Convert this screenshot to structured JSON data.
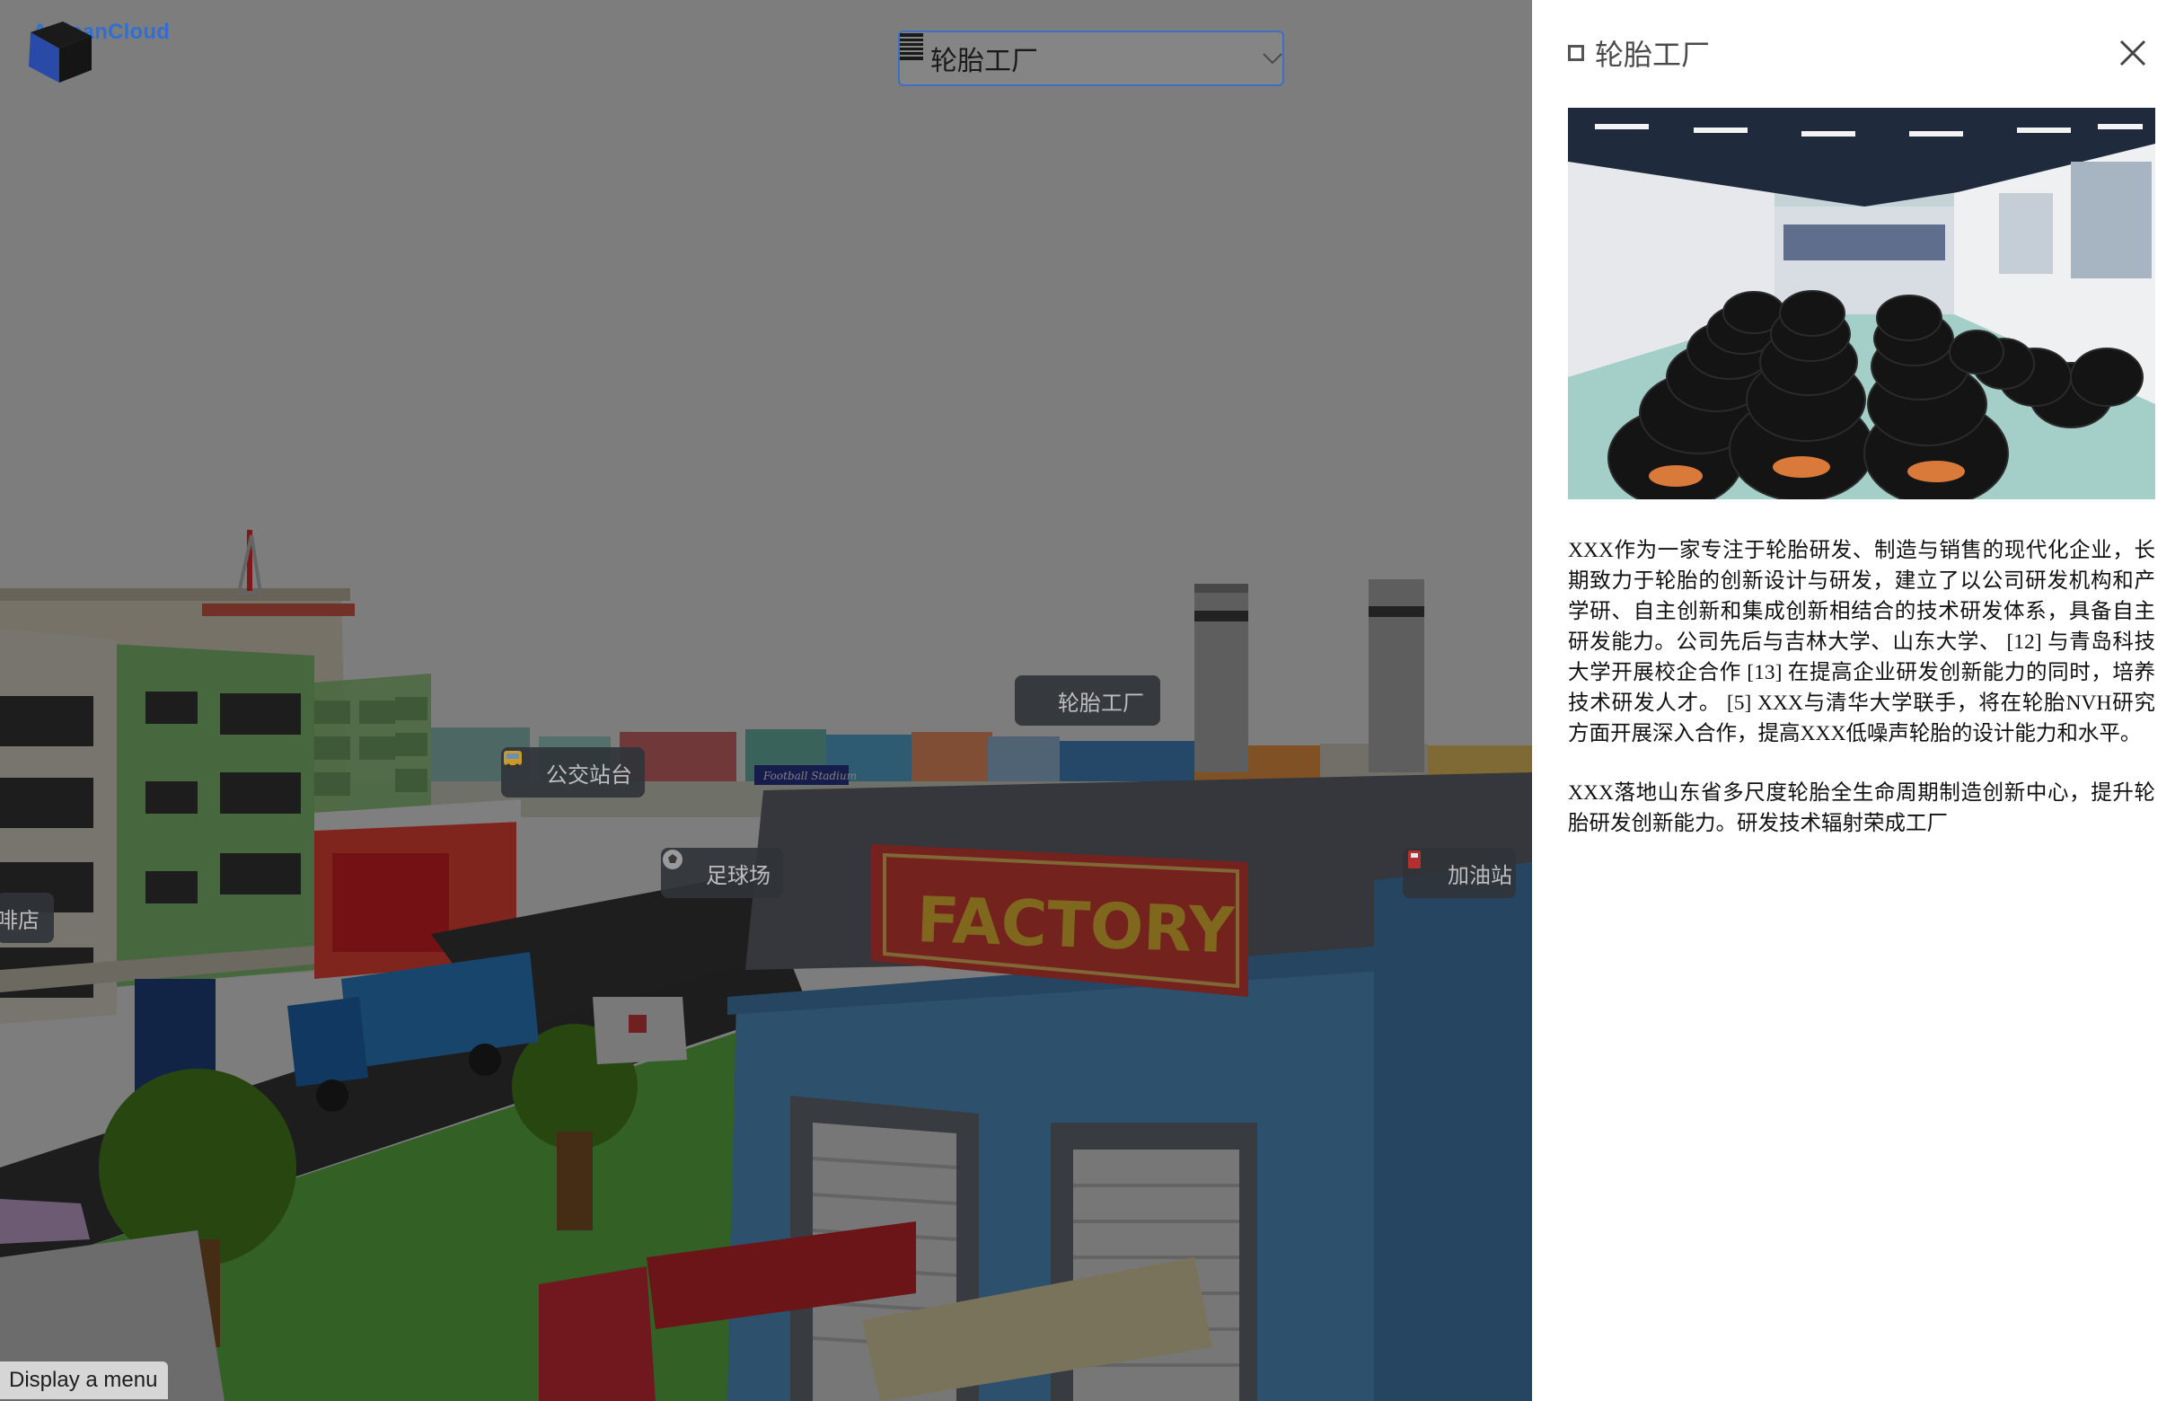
{
  "app": {
    "logo_text": "ArtisanCloud"
  },
  "location_select": {
    "selected": "轮胎工厂"
  },
  "scene": {
    "labels": {
      "bus_stop": "公交站台",
      "football": "足球场",
      "gas_station": "加油站",
      "tire_factory": "轮胎工厂",
      "cafe_partial": "啡店"
    },
    "signs": {
      "factory": "FACTORY",
      "stadium": "Football Stadium"
    }
  },
  "menu_button": {
    "label": "Display a menu"
  },
  "detail_panel": {
    "title": "轮胎工厂",
    "paragraphs": [
      "XXX作为一家专注于轮胎研发、制造与销售的现代化企业，长期致力于轮胎的创新设计与研发，建立了以公司研发机构和产学研、自主创新和集成创新相结合的技术研发体系，具备自主研发能力。公司先后与吉林大学、山东大学、 [12] 与青岛科技大学开展校企合作 [13] 在提高企业研发创新能力的同时，培养技术研发人才。 [5] XXX与清华大学联手，将在轮胎NVH研究方面开展深入合作，提高XXX低噪声轮胎的设计能力和水平。",
      "XXX落地山东省多尺度轮胎全生命周期制造创新中心，提升轮胎研发创新能力。研发技术辐射荣成工厂"
    ]
  }
}
